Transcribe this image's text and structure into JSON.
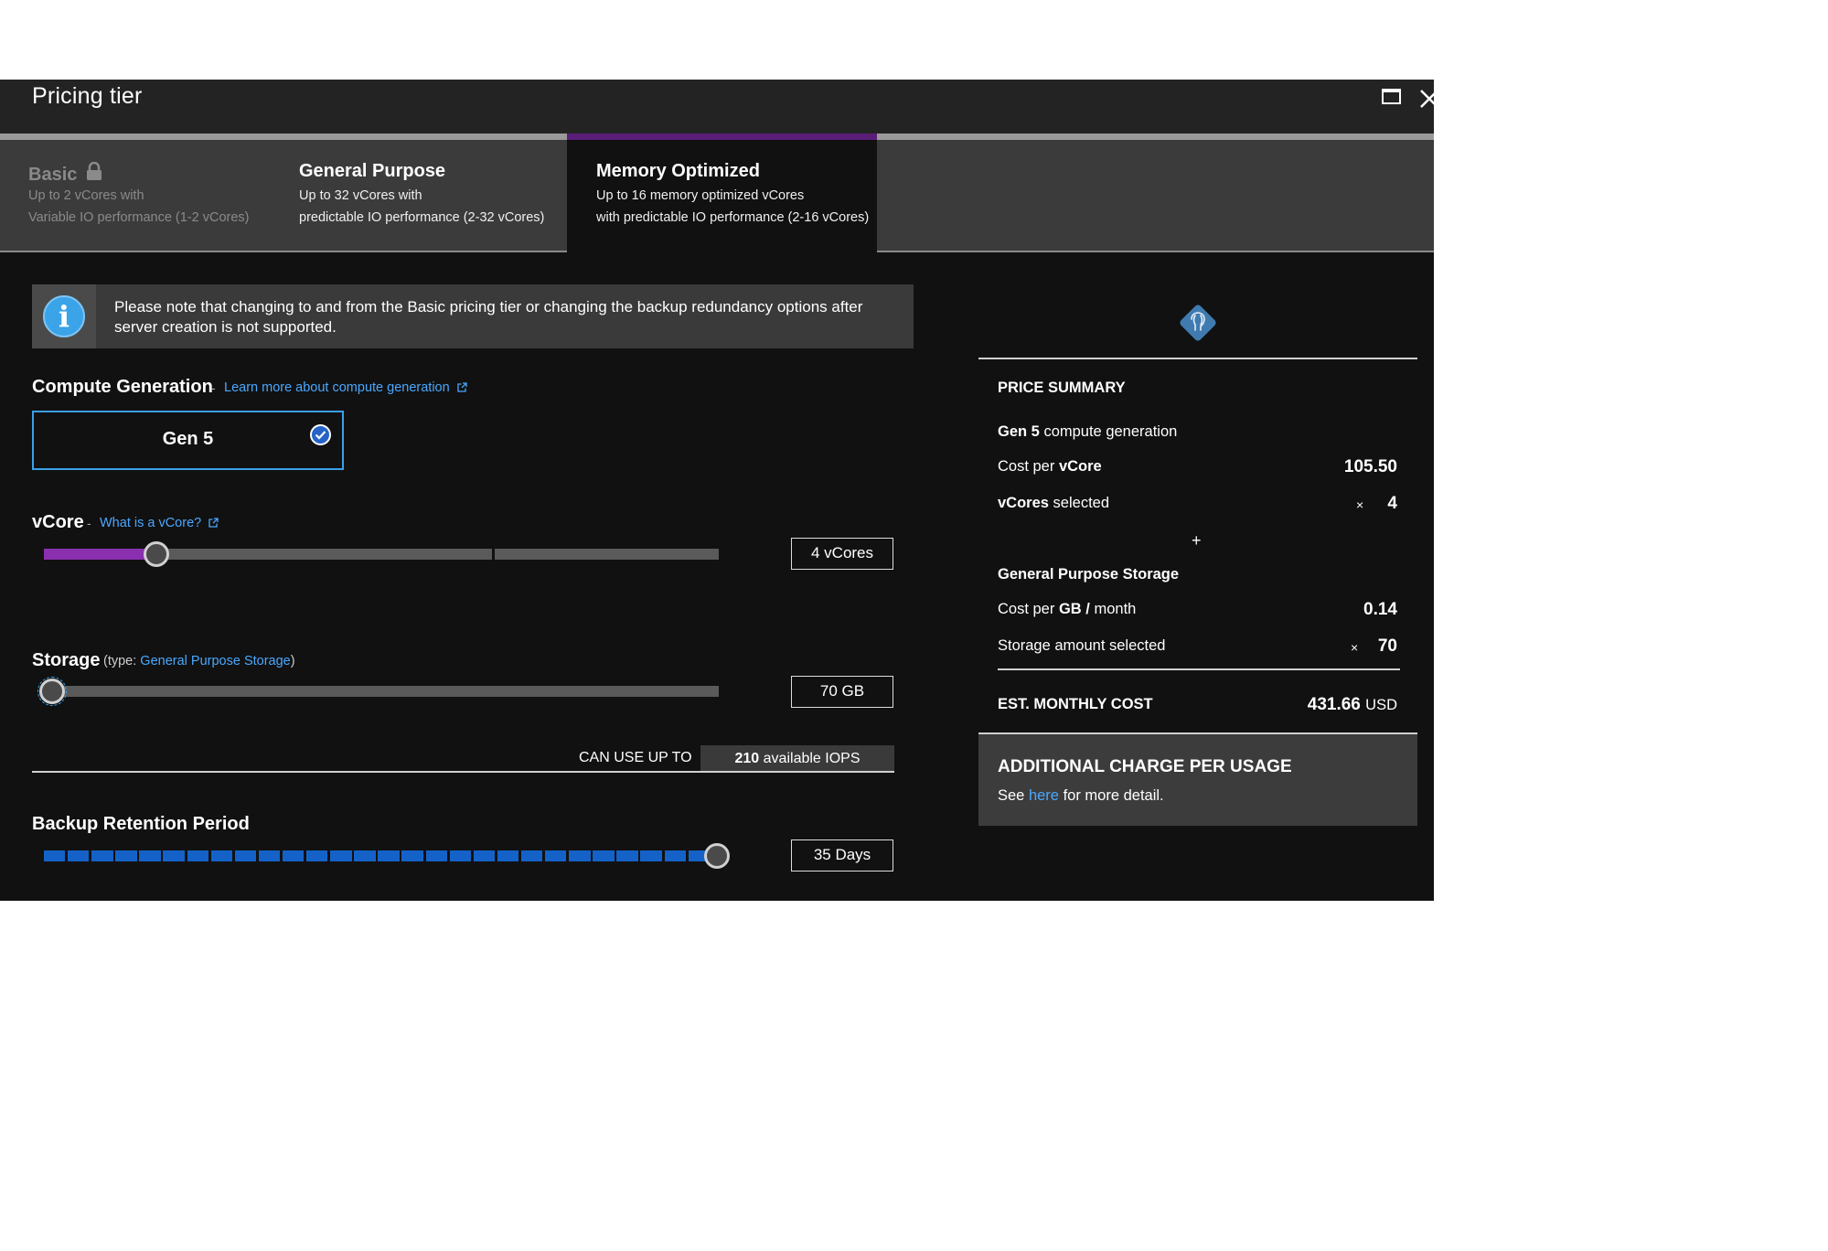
{
  "window": {
    "title": "Pricing tier"
  },
  "tabs": [
    {
      "title": "Basic",
      "line1": "Up to 2 vCores with",
      "line2": "Variable IO performance (1-2 vCores)",
      "locked": true
    },
    {
      "title": "General Purpose",
      "line1": "Up to 32 vCores with",
      "line2": "predictable IO performance (2-32 vCores)"
    },
    {
      "title": "Memory Optimized",
      "line1": "Up to 16 memory optimized vCores",
      "line2": "with predictable IO performance (2-16 vCores)",
      "active": true
    }
  ],
  "info": {
    "text": "Please note that changing to and from the Basic pricing tier or changing the backup redundancy options after server creation is not supported."
  },
  "compute": {
    "label": "Compute Generation",
    "link": "Learn more about compute generation",
    "option": "Gen 5",
    "selected": true
  },
  "vcore": {
    "label": "vCore",
    "link": "What is a vCore?",
    "value_text": "4 vCores",
    "value": 4,
    "max": 16
  },
  "storage": {
    "label": "Storage",
    "type_prefix": "(type:",
    "type_link": "General Purpose Storage",
    "type_suffix": ")",
    "value_text": "70 GB",
    "fraction": 0.0
  },
  "iops": {
    "label": "CAN USE UP TO",
    "value": "210",
    "unit": "available IOPS"
  },
  "backup": {
    "label": "Backup Retention Period",
    "value_text": "35 Days",
    "fraction": 1.0,
    "segments": 28
  },
  "summary": {
    "heading": "PRICE SUMMARY",
    "gen_bold": "Gen 5",
    "gen_rest": "compute generation",
    "cost_vcore_pre": "Cost per",
    "cost_vcore_bold": "vCore",
    "cost_vcore_value": "105.50",
    "vcores_bold": "vCores",
    "vcores_rest": "selected",
    "mult": "×",
    "vcores_value": "4",
    "plus": "+",
    "storage_heading": "General Purpose Storage",
    "cost_gb_pre": "Cost per",
    "cost_gb_bold": "GB /",
    "cost_gb_rest": "month",
    "cost_gb_value": "0.14",
    "storage_amount_label": "Storage amount selected",
    "storage_amount_value": "70",
    "est_label": "EST. MONTHLY COST",
    "est_value": "431.66",
    "est_unit": "USD",
    "additional_title": "ADDITIONAL CHARGE PER USAGE",
    "additional_pre": "See",
    "additional_link": "here",
    "additional_post": "for more detail."
  },
  "colors": {
    "accent_purple": "#8a2fb0",
    "active_tab_top": "#5b1e78",
    "link_blue": "#4aa8ff",
    "backup_blue": "#1462c8",
    "focus_blue": "#3aa0e8"
  },
  "icons": [
    "lock-icon",
    "info-icon",
    "external-link-icon",
    "check-icon",
    "postgres-icon",
    "maximize-icon",
    "close-icon"
  ]
}
